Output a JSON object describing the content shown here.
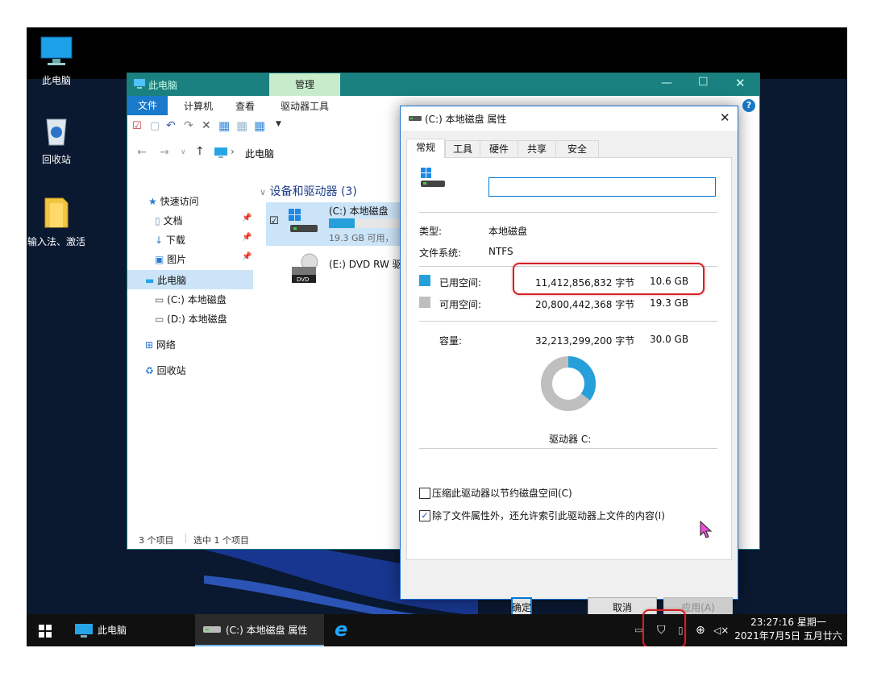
{
  "desktop": {
    "icons": [
      {
        "label": "此电脑"
      },
      {
        "label": "回收站"
      },
      {
        "label": "输入法、激活"
      }
    ]
  },
  "explorer": {
    "title": "此电脑",
    "context_tab": "管理",
    "ribbon_tabs": [
      "文件",
      "计算机",
      "查看",
      "驱动器工具"
    ],
    "address": "此电脑",
    "nav": {
      "quick_access": "快速访问",
      "documents": "文档",
      "downloads": "下载",
      "pictures": "图片",
      "this_pc": "此电脑",
      "drive_c": "(C:) 本地磁盘",
      "drive_d": "(D:) 本地磁盘",
      "network": "网络",
      "recycle": "回收站"
    },
    "group_header": "设备和驱动器 (3)",
    "items": [
      {
        "name": "(C:) 本地磁盘",
        "sub": "19.3 GB 可用，",
        "fill": 0.35
      },
      {
        "name": "(E:) DVD RW 驱",
        "sub": ""
      }
    ],
    "status": {
      "count": "3 个项目",
      "selected": "选中 1 个项目"
    }
  },
  "props": {
    "title": "(C:) 本地磁盘 属性",
    "tabs": [
      "常规",
      "工具",
      "硬件",
      "共享",
      "安全"
    ],
    "name_value": "",
    "type_label": "类型:",
    "type_value": "本地磁盘",
    "fs_label": "文件系统:",
    "fs_value": "NTFS",
    "used_label": "已用空间:",
    "used_bytes": "11,412,856,832 字节",
    "used_gb": "10.6 GB",
    "free_label": "可用空间:",
    "free_bytes": "20,800,442,368 字节",
    "free_gb": "19.3 GB",
    "cap_label": "容量:",
    "cap_bytes": "32,213,299,200 字节",
    "cap_gb": "30.0 GB",
    "drive_label": "驱动器 C:",
    "compress_label": "压缩此驱动器以节约磁盘空间(C)",
    "index_label": "除了文件属性外，还允许索引此驱动器上文件的内容(I)",
    "ok": "确定",
    "cancel": "取消",
    "apply": "应用(A)",
    "colors": {
      "used": "#26a0da",
      "free": "#bfbfbf"
    }
  },
  "taskbar": {
    "items": [
      "此电脑",
      "(C:) 本地磁盘 属性"
    ],
    "time": "23:27:16 星期一",
    "date": "2021年7月5日 五月廿六"
  }
}
